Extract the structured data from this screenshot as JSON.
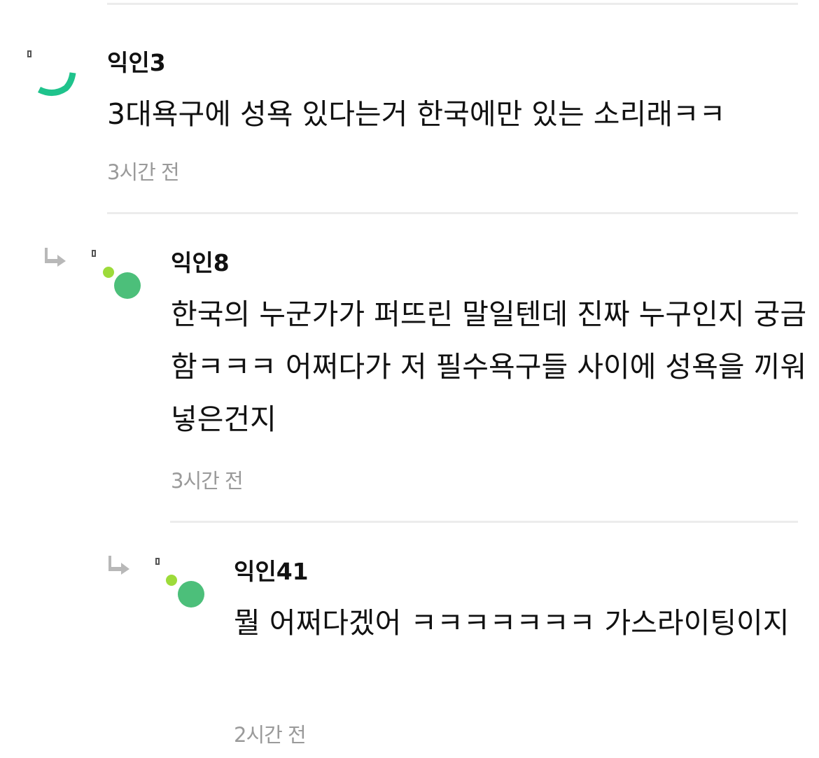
{
  "comments": [
    {
      "author": "익인3",
      "body": "3대욕구에 성욕 있다는거 한국에만 있는 소리래ㅋㅋ",
      "time": "3시간 전",
      "avatar": "green-arc-avatar"
    },
    {
      "author": "익인8",
      "body": "한국의 누군가가 퍼뜨린 말일텐데 진짜 누구인지 궁금함ㅋㅋㅋ 어쩌다가 저 필수욕구들 사이에 성욕을 끼워넣은건지",
      "time": "3시간 전",
      "avatar": "green-dots-avatar",
      "is_reply": true
    },
    {
      "author": "익인41",
      "body": "뭘 어쩌다겠어 ㅋㅋㅋㅋㅋㅋㅋ 가스라이팅이지",
      "time": "2시간 전",
      "avatar": "green-dots-avatar",
      "is_reply": true
    }
  ],
  "icons": {
    "reply": "reply-arrow-icon",
    "broken_image": "broken-image-icon"
  },
  "colors": {
    "text": "#111111",
    "timestamp": "#9a9a9a",
    "divider": "#ececec",
    "avatar_arc": "#1fc38c",
    "avatar_dot_small": "#9ddb3a",
    "avatar_dot_big": "#4cbf7a",
    "reply_arrow": "#b8b8b8"
  }
}
